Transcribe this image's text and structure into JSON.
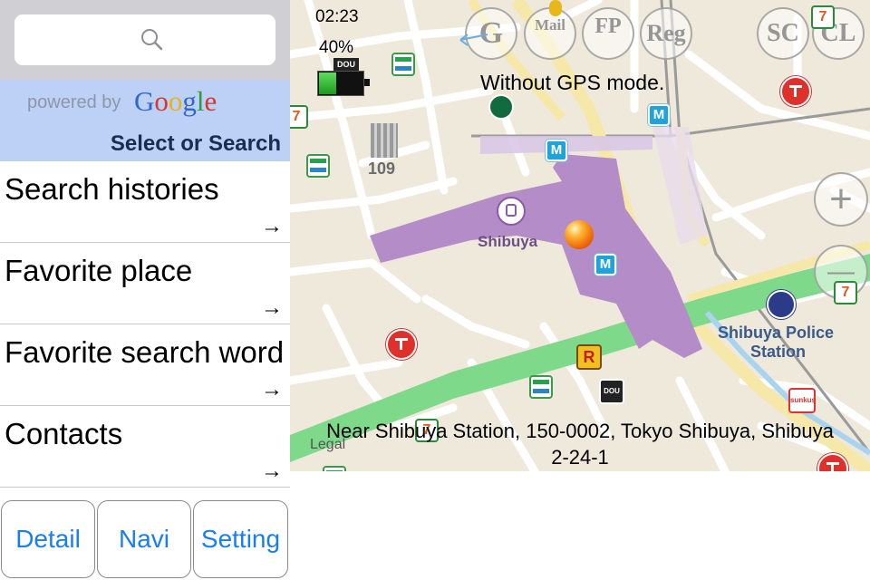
{
  "search": {
    "placeholder": ""
  },
  "google_bar": {
    "powered_by": "powered by",
    "google_letters": [
      "G",
      "o",
      "o",
      "g",
      "l",
      "e"
    ],
    "google_colors": [
      "#3366cc",
      "#d03a2f",
      "#e8b21c",
      "#3366cc",
      "#2e9a44",
      "#d03a2f"
    ],
    "select_label": "Select or Search"
  },
  "menu": [
    {
      "label": "Search histories",
      "arrow": "→"
    },
    {
      "label": "Favorite place",
      "arrow": "→"
    },
    {
      "label": "Favorite search word",
      "arrow": "→"
    },
    {
      "label": "Contacts",
      "arrow": "→"
    }
  ],
  "buttons": {
    "detail": "Detail",
    "navi": "Navi",
    "setting": "Setting"
  },
  "map": {
    "status": {
      "time": "02:23",
      "battery_percent": "40%",
      "dou_badge": "DOU",
      "battery_level": 0.4
    },
    "top_buttons": {
      "g": "G",
      "mail": "Mail",
      "fp": "FP",
      "reg": "Reg",
      "sc": "SC",
      "cl": "CL"
    },
    "mode_text": "Without GPS mode.",
    "station_label": "Shibuya",
    "building_label": "109",
    "police_label_line1": "Shibuya Police",
    "police_label_line2": "Station",
    "address_line1": "Near Shibuya Station, 150-0002, Tokyo Shibuya, Shibuya",
    "address_line2": "2-24-1",
    "legal": "Legal",
    "zoom_in": "+",
    "zoom_out": "—",
    "poi_711_text": "7",
    "poi_metro_text": "M",
    "poi_r_text": "R",
    "poi_dou_text": "DOU",
    "poi_sunkus_text": "sunkus",
    "colors": {
      "station_area": "#b48cc8",
      "green_belt": "#7fd98a",
      "road_yellow": "#f6e8a8",
      "land": "#efe9dc"
    }
  }
}
